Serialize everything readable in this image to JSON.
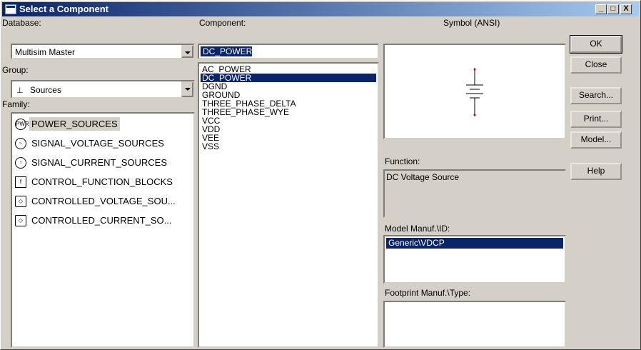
{
  "window": {
    "title": "Select a Component"
  },
  "labels": {
    "database": "Database:",
    "group": "Group:",
    "family": "Family:",
    "component": "Component:",
    "symbol": "Symbol (ANSI)",
    "function": "Function:",
    "model_manuf": "Model Manuf.\\ID:",
    "footprint_manuf": "Footprint Manuf.\\Type:"
  },
  "database": {
    "value": "Multisim Master"
  },
  "group": {
    "value": "Sources",
    "icon": "sources-icon"
  },
  "family_items": [
    {
      "label": "POWER_SOURCES",
      "icon": "power-sources-icon"
    },
    {
      "label": "SIGNAL_VOLTAGE_SOURCES",
      "icon": "signal-voltage-sources-icon"
    },
    {
      "label": "SIGNAL_CURRENT_SOURCES",
      "icon": "signal-current-sources-icon"
    },
    {
      "label": "CONTROL_FUNCTION_BLOCKS",
      "icon": "control-function-blocks-icon"
    },
    {
      "label": "CONTROLLED_VOLTAGE_SOU...",
      "icon": "controlled-voltage-sources-icon"
    },
    {
      "label": "CONTROLLED_CURRENT_SO...",
      "icon": "controlled-current-sources-icon"
    }
  ],
  "component": {
    "input_value": "DC_POWER",
    "items": [
      "AC_POWER",
      "DC_POWER",
      "DGND",
      "GROUND",
      "THREE_PHASE_DELTA",
      "THREE_PHASE_WYE",
      "VCC",
      "VDD",
      "VEE",
      "VSS"
    ],
    "selected": "DC_POWER"
  },
  "function": {
    "value": "DC Voltage Source"
  },
  "model_manuf": {
    "items": [
      "Generic\\VDCP"
    ]
  },
  "buttons": {
    "ok": "OK",
    "close": "Close",
    "search": "Search...",
    "print": "Print...",
    "model": "Model...",
    "help": "Help"
  },
  "title_buttons": {
    "minimize": "_",
    "maximize": "□",
    "close": "X"
  }
}
